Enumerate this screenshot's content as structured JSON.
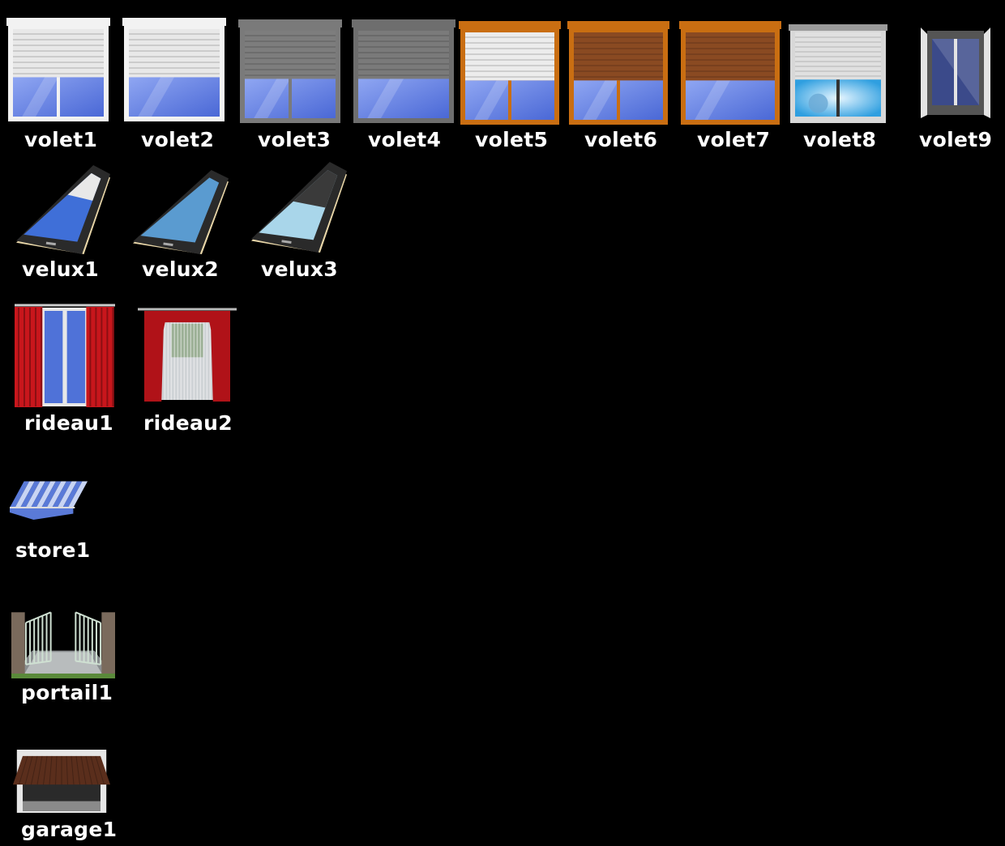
{
  "icons": [
    {
      "id": "volet1",
      "label": "volet1",
      "type": "volet",
      "frame_color": "#f2f2f2",
      "slat_color": "#e8e8e8",
      "shutter_portion": 0.55,
      "pane_split": true
    },
    {
      "id": "volet2",
      "label": "volet2",
      "type": "volet",
      "frame_color": "#f2f2f2",
      "slat_color": "#e8e8e8",
      "shutter_portion": 0.55,
      "pane_split": false
    },
    {
      "id": "volet3",
      "label": "volet3",
      "type": "volet",
      "frame_color": "#7a7a7a",
      "slat_color": "#7d7d7d",
      "shutter_portion": 0.55,
      "pane_split": true
    },
    {
      "id": "volet4",
      "label": "volet4",
      "type": "volet",
      "frame_color": "#6e6e6e",
      "slat_color": "#7a7a7a",
      "shutter_portion": 0.55,
      "pane_split": false
    },
    {
      "id": "volet5",
      "label": "volet5",
      "type": "volet",
      "frame_color": "#c96e12",
      "slat_color": "#ececec",
      "shutter_portion": 0.55,
      "pane_split": true
    },
    {
      "id": "volet6",
      "label": "volet6",
      "type": "volet",
      "frame_color": "#c96e12",
      "slat_color": "#8a4a22",
      "shutter_portion": 0.55,
      "pane_split": true
    },
    {
      "id": "volet7",
      "label": "volet7",
      "type": "volet",
      "frame_color": "#c96e12",
      "slat_color": "#8a4a22",
      "shutter_portion": 0.55,
      "pane_split": false
    },
    {
      "id": "volet8",
      "label": "volet8",
      "type": "volet8",
      "frame_color": "#d8d8d8",
      "slat_color": "#e0e0e0",
      "shutter_portion": 0.55,
      "pane_split": true
    },
    {
      "id": "volet9",
      "label": "volet9",
      "type": "volet9",
      "frame_color": "#e4e4e4",
      "glass_color": "#3b4a8a"
    },
    {
      "id": "velux1",
      "label": "velux1",
      "type": "velux",
      "frame_color": "#2a2a2a",
      "glass_color": "#3f6fd8",
      "blind_portion": 0.35,
      "blind_color": "#e8e8e8"
    },
    {
      "id": "velux2",
      "label": "velux2",
      "type": "velux",
      "frame_color": "#2a2a2a",
      "glass_color": "#5a9bd0",
      "blind_portion": 0,
      "blind_color": "#e8e8e8"
    },
    {
      "id": "velux3",
      "label": "velux3",
      "type": "velux",
      "frame_color": "#2a2a2a",
      "glass_color": "#a9d6ea",
      "blind_portion": 0.5,
      "blind_color": "#3a3a3a"
    },
    {
      "id": "rideau1",
      "label": "rideau1",
      "type": "rideau",
      "curtain_color": "#c8161c",
      "glass_color": "#4f72d8"
    },
    {
      "id": "rideau2",
      "label": "rideau2",
      "type": "rideau2",
      "curtain_color": "#b01218",
      "glass_color": "#cfd3d6"
    },
    {
      "id": "store1",
      "label": "store1",
      "type": "store",
      "stripe_a": "#5a7ad8",
      "stripe_b": "#c8d4f4"
    },
    {
      "id": "portail1",
      "label": "portail1",
      "type": "portail",
      "gate_color": "#cfe0d2",
      "ground_color": "#8a8e90"
    },
    {
      "id": "garage1",
      "label": "garage1",
      "type": "garage",
      "door_color": "#5a2e1c",
      "frame_color": "#e6e6e6"
    }
  ]
}
